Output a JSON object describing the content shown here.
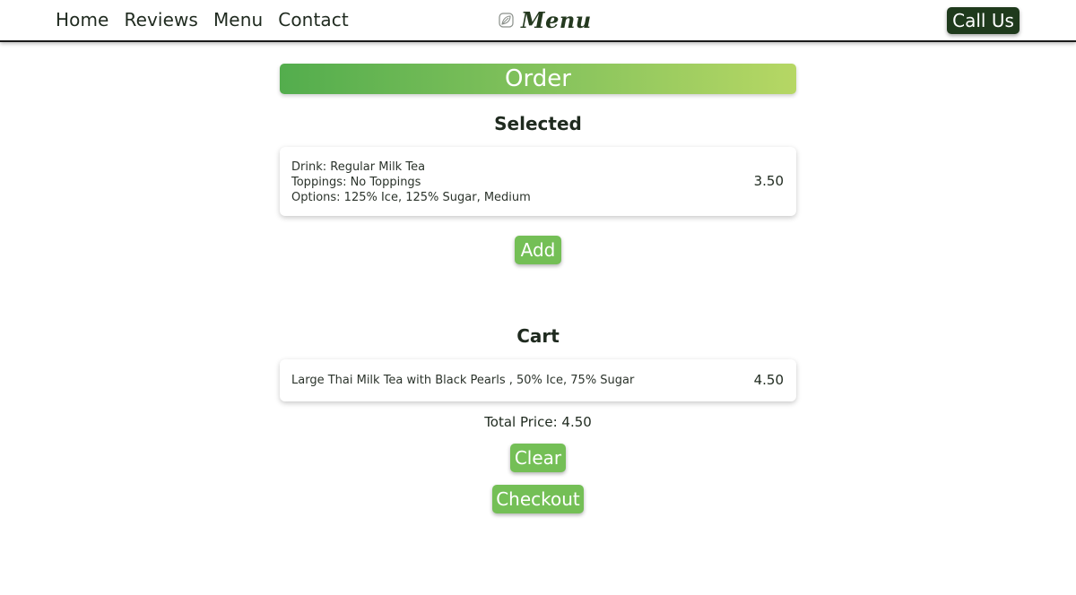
{
  "nav": {
    "links": [
      "Home",
      "Reviews",
      "Menu",
      "Contact"
    ],
    "brand": "Menu",
    "brand_icon": "leaf-icon",
    "call_label": "Call Us"
  },
  "order": {
    "banner_title": "Order",
    "selected_heading": "Selected",
    "selected_item": {
      "drink_line": "Drink: Regular Milk Tea",
      "toppings_line": "Toppings: No Toppings",
      "options_line": "Options: 125% Ice, 125% Sugar, Medium",
      "price": "3.50"
    },
    "add_label": "Add",
    "cart_heading": "Cart",
    "cart_items": [
      {
        "description": "Large Thai Milk Tea with Black Pearls , 50% Ice, 75% Sugar",
        "price": "4.50"
      }
    ],
    "total_text": "Total Price: 4.50",
    "clear_label": "Clear",
    "checkout_label": "Checkout"
  },
  "colors": {
    "dark_green": "#1f3a1c",
    "button_green": "#74bf56",
    "gradient_start": "#53ad4d",
    "gradient_end": "#b6d764"
  }
}
